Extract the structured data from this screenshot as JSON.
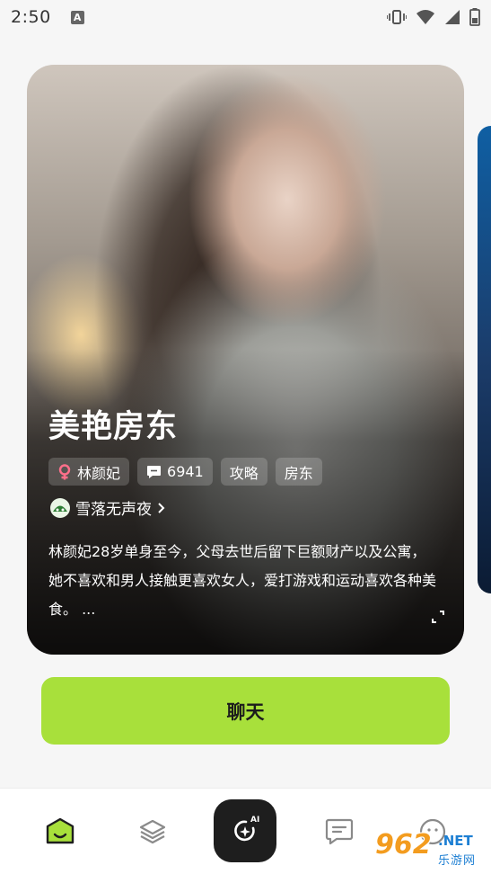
{
  "status_bar": {
    "time": "2:50",
    "app_badge": "A"
  },
  "card": {
    "title": "美艳房东",
    "tags": [
      {
        "icon": "female-icon",
        "label": "林颜妃"
      },
      {
        "icon": "message-count-icon",
        "label": "6941"
      },
      {
        "label": "攻略"
      },
      {
        "label": "房东"
      }
    ],
    "author": {
      "name": "雪落无声夜"
    },
    "description": "林颜妃28岁单身至今，父母去世后留下巨额财产以及公寓，她不喜欢和男人接触更喜欢女人，爱打游戏和运动喜欢各种美食。 ..."
  },
  "actions": {
    "chat_label": "聊天"
  },
  "bottom_nav": {
    "items": [
      {
        "icon": "home-face-icon",
        "active": true
      },
      {
        "icon": "layers-icon",
        "active": false
      },
      {
        "icon": "ai-create-icon",
        "badge": "AI"
      },
      {
        "icon": "message-icon",
        "active": false
      },
      {
        "icon": "profile-icon",
        "active": false
      }
    ]
  },
  "watermark": {
    "number": "962",
    "suffix": ".NET",
    "site": "乐游网"
  },
  "colors": {
    "accent": "#a8e03b",
    "nav_active": "#a8e03b",
    "female": "#ff6f8a"
  }
}
